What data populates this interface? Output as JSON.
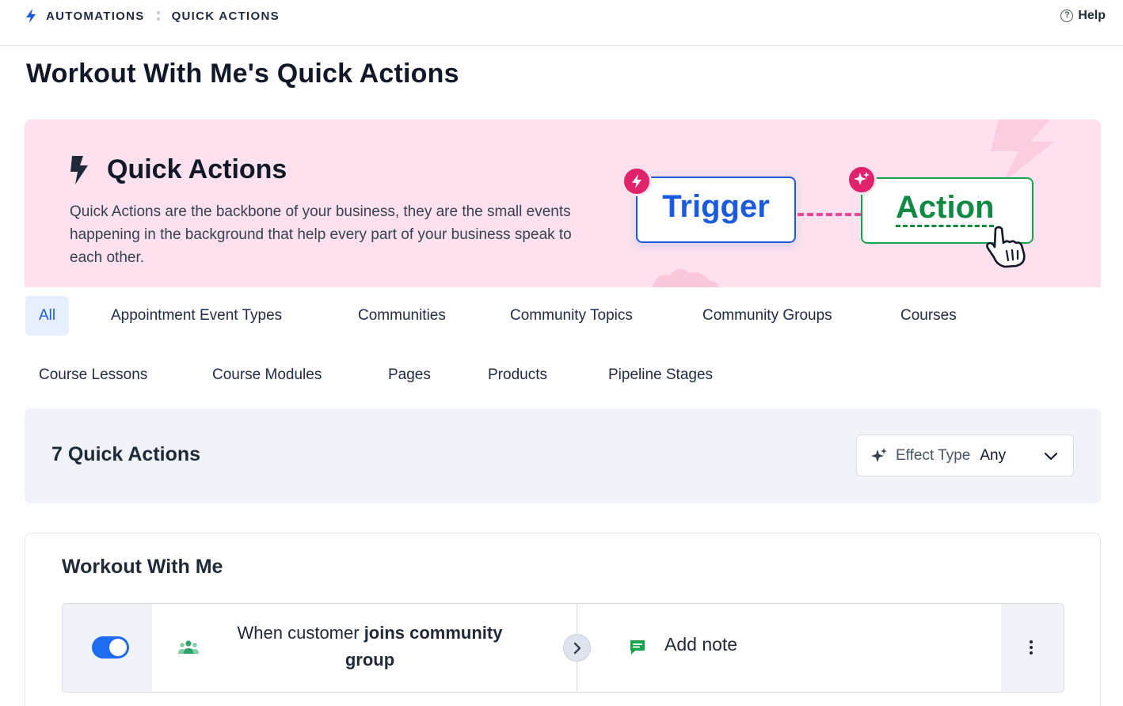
{
  "breadcrumb": {
    "icon": "lightning-bolt-icon",
    "items": [
      "AUTOMATIONS",
      "QUICK ACTIONS"
    ]
  },
  "help": {
    "label": "Help",
    "icon": "question-circle-icon"
  },
  "page_title": "Workout With Me's Quick Actions",
  "hero": {
    "icon": "lightning-bolt-icon",
    "title": "Quick Actions",
    "description": "Quick Actions are the backbone of your business, they are the small events happening in the background that help every part of your business speak to each other.",
    "illustration": {
      "trigger_label": "Trigger",
      "action_label": "Action",
      "trigger_color": "#1a5be0",
      "action_color": "#0f8a43",
      "badge_color": "#e0226b"
    },
    "background_color": "#fde1ee"
  },
  "tabs": [
    {
      "label": "All",
      "active": true
    },
    {
      "label": "Appointment Event Types"
    },
    {
      "label": "Communities"
    },
    {
      "label": "Community Topics"
    },
    {
      "label": "Community Groups"
    },
    {
      "label": "Courses"
    },
    {
      "label": "Course Lessons"
    },
    {
      "label": "Course Modules"
    },
    {
      "label": "Pages"
    },
    {
      "label": "Products"
    },
    {
      "label": "Pipeline Stages"
    }
  ],
  "summary": {
    "count_label": "7 Quick Actions",
    "filter": {
      "icon": "sparkles-icon",
      "label": "Effect Type",
      "value": "Any"
    }
  },
  "groups": [
    {
      "title": "Workout With Me",
      "actions": [
        {
          "enabled": true,
          "trigger_icon": "users-icon",
          "trigger_prefix": "When customer ",
          "trigger_bold": "joins community group",
          "action_icon": "note-icon",
          "action_label": "Add note"
        }
      ]
    }
  ],
  "colors": {
    "accent": "#1e5bd8",
    "toggle_on": "#1e6bf0",
    "tab_active_bg": "#e6efff",
    "panel_bg": "#f0f3f8"
  }
}
